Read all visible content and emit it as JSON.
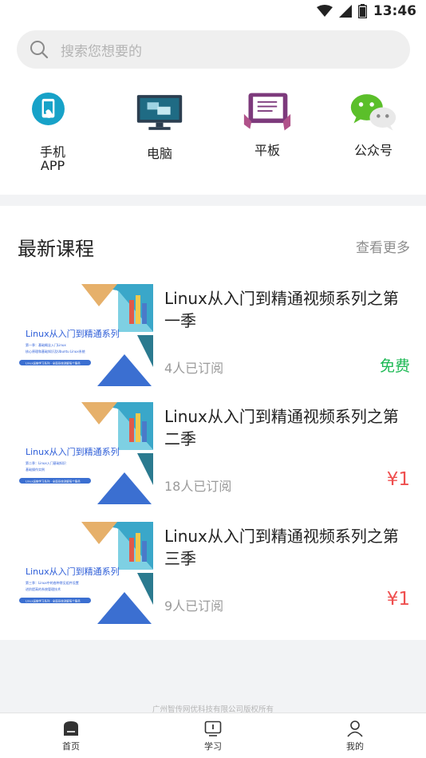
{
  "status_bar": {
    "time": "13:46",
    "icons": [
      "wifi-icon",
      "signal-icon",
      "battery-icon"
    ]
  },
  "search": {
    "placeholder": "搜索您想要的"
  },
  "categories": [
    {
      "label": "手机\nAPP",
      "icon": "phone-app-icon",
      "color": "#17a2c8"
    },
    {
      "label": "电脑",
      "icon": "desktop-computer-icon",
      "color": "#1f6b84"
    },
    {
      "label": "平板",
      "icon": "tablet-icon",
      "color": "#7d3a7c"
    },
    {
      "label": "公众号",
      "icon": "wechat-icon",
      "color": "#5bbf2a"
    }
  ],
  "section": {
    "title": "最新课程",
    "more": "查看更多"
  },
  "courses": [
    {
      "title": "Linux从入门到精通视频系列之第一季",
      "subscribers": "4人已订阅",
      "price": "免费",
      "thumb": {
        "title": "Linux从入门到精通系列",
        "line1": "第一季：基础概念入门Linux",
        "line2": "核心原理和基础知识及Ubuntu Linux系统",
        "banner": "Linux运维学习系列 · 全面系统讲解每个服务"
      }
    },
    {
      "title": "Linux从入门到精通视频系列之第二季",
      "subscribers": "18人已订阅",
      "price": "¥1",
      "thumb": {
        "title": "Linux从入门到精通系列",
        "line1": "第二季：Linux入门基础知识",
        "line2": "基础操作实例",
        "banner": "Linux运维学习系列 · 全面系统讲解每个服务"
      }
    },
    {
      "title": "Linux从入门到精通视频系列之第三季",
      "subscribers": "9人已订阅",
      "price": "¥1",
      "thumb": {
        "title": "Linux从入门到精通系列",
        "line1": "第三季：Linux中的各种常见组件设置",
        "line2": "进阶提高的系统管理技术",
        "banner": "Linux运维学习系列 · 全面系统讲解每个服务"
      }
    }
  ],
  "footer": {
    "copyright": "广州智传网优科技有限公司版权所有"
  },
  "tabs": [
    {
      "label": "首页",
      "icon": "home-icon"
    },
    {
      "label": "学习",
      "icon": "study-icon"
    },
    {
      "label": "我的",
      "icon": "profile-icon"
    }
  ],
  "colors": {
    "free": "#1db954",
    "price": "#ef4f4f",
    "background": "#f2f3f5"
  }
}
